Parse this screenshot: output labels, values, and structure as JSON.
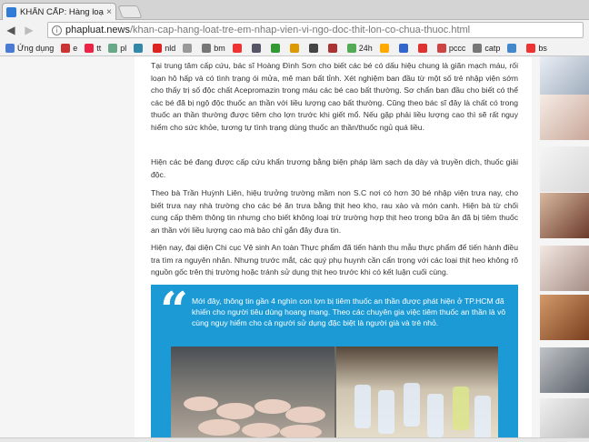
{
  "browser": {
    "tab_title": "KHẨN CẤP: Hàng loạt trẻ",
    "tab_close": "×",
    "url_host": "phapluat.news",
    "url_path": "/khan-cap-hang-loat-tre-em-nhap-vien-vi-ngo-doc-thit-lon-co-chua-thuoc.html",
    "bookmarks": [
      {
        "label": "Ứng dụng",
        "icon": "apps-grid-icon",
        "color": "#4a7bd0"
      },
      {
        "label": "e",
        "icon": "e-icon",
        "color": "#c33"
      },
      {
        "label": "tt",
        "icon": "tt-icon",
        "color": "#e24"
      },
      {
        "label": "pl",
        "icon": "pl-icon",
        "color": "#6a8"
      },
      {
        "label": "",
        "icon": "globe-icon",
        "color": "#38a"
      },
      {
        "label": "nld",
        "icon": "nld-icon",
        "color": "#d22"
      },
      {
        "label": "",
        "icon": "round-icon",
        "color": "#999"
      },
      {
        "label": "bm",
        "icon": "bm-icon",
        "color": "#777"
      },
      {
        "label": "",
        "icon": "check-icon",
        "color": "#e33"
      },
      {
        "label": "",
        "icon": "z-icon",
        "color": "#556"
      },
      {
        "label": "",
        "icon": "d-icon",
        "color": "#393"
      },
      {
        "label": "",
        "icon": "star-icon",
        "color": "#d90"
      },
      {
        "label": "",
        "icon": "fly-icon",
        "color": "#444"
      },
      {
        "label": "",
        "icon": "dot-icon",
        "color": "#a33"
      },
      {
        "label": "24h",
        "icon": "24h-icon",
        "color": "#5a5"
      },
      {
        "label": "",
        "icon": "circle-icon",
        "color": "#fa0"
      },
      {
        "label": "",
        "icon": "pin-icon",
        "color": "#36c"
      },
      {
        "label": "",
        "icon": "red-icon",
        "color": "#d33"
      },
      {
        "label": "pccc",
        "icon": "pccc-icon",
        "color": "#c44"
      },
      {
        "label": "catp",
        "icon": "catp-icon",
        "color": "#777"
      },
      {
        "label": "",
        "icon": "ns-icon",
        "color": "#48c"
      },
      {
        "label": "bs",
        "icon": "bs-icon",
        "color": "#e33"
      }
    ]
  },
  "article": {
    "paragraphs": [
      "Tại trung tâm cấp cứu, bác sĩ Hoàng Đình Sơn cho biết các bé có dấu hiệu chung là giãn mạch máu, rối loạn hô hấp và có tình trạng ói mửa, mê man bất tỉnh. Xét nghiệm ban đầu từ một số trẻ nhập viện sớm cho thấy trị số độc chất Acepromazin trong máu các bé cao bất thường. Sơ chẩn ban đầu cho biết có thể các bé đã bị ngộ độc thuốc an thần với liều lượng cao bất thường. Cũng theo bác sĩ đây là chất có trong thuốc an thần thường được tiêm cho lợn trước khi giết mổ. Nếu gặp phải liều lượng cao thì sẽ rất nguy hiểm cho sức khỏe, tương tự tình trạng dùng thuốc an thần/thuốc ngủ quá liều.",
      "Hiện các bé đang được cấp cứu khẩn trương bằng biện pháp làm sạch dạ dày và truyền dịch, thuốc giải độc.",
      "Theo bà Trần Huỳnh Liên, hiệu trưởng trường mầm non S.C nơi có hơn 30 bé nhập viện trưa nay, cho biết trưa nay nhà trường cho các bé ăn trưa bằng thịt heo kho, rau xào và món canh. Hiện bà từ chối cung cấp thêm thông tin nhưng cho biết không loại trừ trường hợp thịt heo trong bữa ăn đã bị tiêm thuốc an thần với liều lượng cao mà bảo chỉ gắn đây đưa tin.",
      "Hiện nay, đại diện Chi cục Vệ sinh An toàn Thực phẩm đã tiến hành thu mẫu thực phẩm để tiến hành điều tra tìm ra nguyên nhân. Nhưng trước mắt, các quý phụ huynh cần cẩn trọng với các loại thịt heo không rõ nguồn gốc trên thị trường hoặc tránh sử dụng thịt heo trước khi có kết luận cuối cùng."
    ],
    "quote_mark": "“",
    "quote_text": "Mới đây, thông tin gần 4 nghìn con lợn bị tiêm thuốc an thần được phát hiện ở TP.HCM đã khiến cho người tiêu dùng hoang mang. Theo các chuyên gia việc tiêm thuốc an thần là vô cùng nguy hiểm cho cả người sử dụng đặc biệt là người già và trẻ nhỏ.",
    "quote_color": "#1b9ad6"
  }
}
